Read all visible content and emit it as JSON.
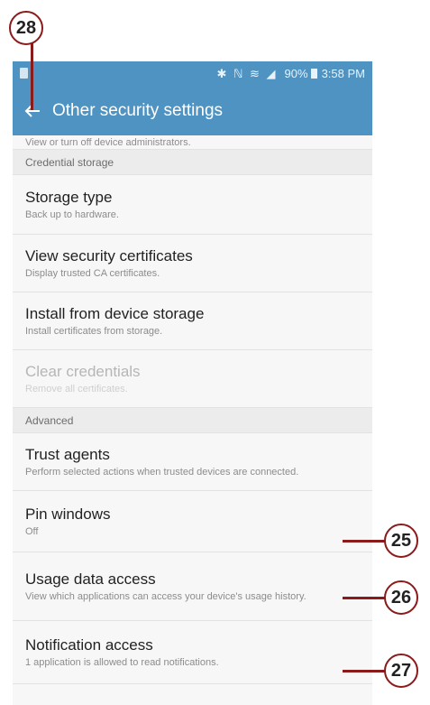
{
  "callouts": {
    "c28": "28",
    "c25": "25",
    "c26": "26",
    "c27": "27"
  },
  "status_bar": {
    "icons": "✱ ℕ ≋ ◢",
    "battery": "90%",
    "time": "3:58 PM"
  },
  "app_bar": {
    "back_icon": "back-arrow-icon",
    "title": "Other security settings"
  },
  "partial_item": {
    "subtitle": "View or turn off device administrators."
  },
  "sections": {
    "credential_storage": "Credential storage",
    "advanced": "Advanced"
  },
  "credential_items": [
    {
      "title": "Storage type",
      "subtitle": "Back up to hardware."
    },
    {
      "title": "View security certificates",
      "subtitle": "Display trusted CA certificates."
    },
    {
      "title": "Install from device storage",
      "subtitle": "Install certificates from storage."
    },
    {
      "title": "Clear credentials",
      "subtitle": "Remove all certificates.",
      "disabled": true
    }
  ],
  "advanced_items": [
    {
      "title": "Trust agents",
      "subtitle": "Perform selected actions when trusted devices are connected."
    },
    {
      "title": "Pin windows",
      "subtitle": "Off"
    },
    {
      "title": "Usage data access",
      "subtitle": "View which applications can access your device's usage history."
    },
    {
      "title": "Notification access",
      "subtitle": "1 application is allowed to read notifications."
    }
  ],
  "colors": {
    "accent": "#4e93c1",
    "callout": "#8b1a1a"
  }
}
